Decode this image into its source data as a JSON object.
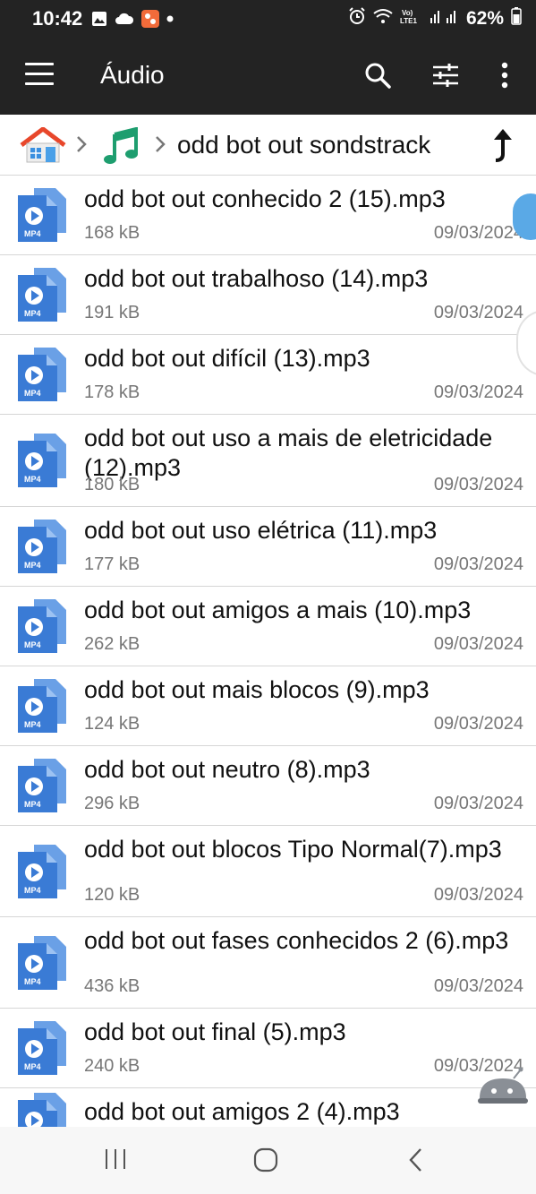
{
  "status_bar": {
    "time": "10:42",
    "battery": "62%",
    "icons": [
      "image-icon",
      "cloud-icon",
      "app-notification-icon",
      "dot-icon",
      "alarm-icon",
      "wifi-icon",
      "volte-icon",
      "signal-icon",
      "battery-icon"
    ]
  },
  "app_bar": {
    "title": "Áudio",
    "icons": [
      "menu-icon",
      "search-icon",
      "filter-icon",
      "more-options-icon"
    ]
  },
  "breadcrumb": {
    "folder": "odd bot out sondstrack",
    "icons": [
      "home-icon",
      "music-note-icon",
      "up-arrow-icon"
    ]
  },
  "files": [
    {
      "name": "odd bot out conhecido 2 (15).mp3",
      "size": "168 kB",
      "date": "09/03/2024"
    },
    {
      "name": "odd bot out trabalhoso (14).mp3",
      "size": "191 kB",
      "date": "09/03/2024"
    },
    {
      "name": "odd bot out difícil (13).mp3",
      "size": "178 kB",
      "date": "09/03/2024"
    },
    {
      "name": "odd bot out uso a mais de eletricidade (12).mp3",
      "size": "180 kB",
      "date": "09/03/2024"
    },
    {
      "name": "odd bot out uso elétrica (11).mp3",
      "size": "177 kB",
      "date": "09/03/2024"
    },
    {
      "name": "odd bot out amigos a mais (10).mp3",
      "size": "262 kB",
      "date": "09/03/2024"
    },
    {
      "name": "odd bot out mais blocos (9).mp3",
      "size": "124 kB",
      "date": "09/03/2024"
    },
    {
      "name": "odd bot out neutro (8).mp3",
      "size": "296 kB",
      "date": "09/03/2024"
    },
    {
      "name": "odd bot out blocos Tipo Normal(7).mp3",
      "size": "120 kB",
      "date": "09/03/2024"
    },
    {
      "name": "odd bot out fases conhecidos 2 (6).mp3",
      "size": "436 kB",
      "date": "09/03/2024"
    },
    {
      "name": "odd bot out final (5).mp3",
      "size": "240 kB",
      "date": "09/03/2024"
    },
    {
      "name": "odd bot out amigos 2 (4).mp3",
      "size": "",
      "date": ""
    }
  ],
  "file_icon_label": "MP4",
  "nav_bar": {
    "icons": [
      "recent-apps-icon",
      "home-button-icon",
      "back-icon"
    ]
  },
  "colors": {
    "bar": "#232323",
    "file_icon": "#3a7bd5",
    "music": "#1e9e6f",
    "meta": "#777777"
  }
}
